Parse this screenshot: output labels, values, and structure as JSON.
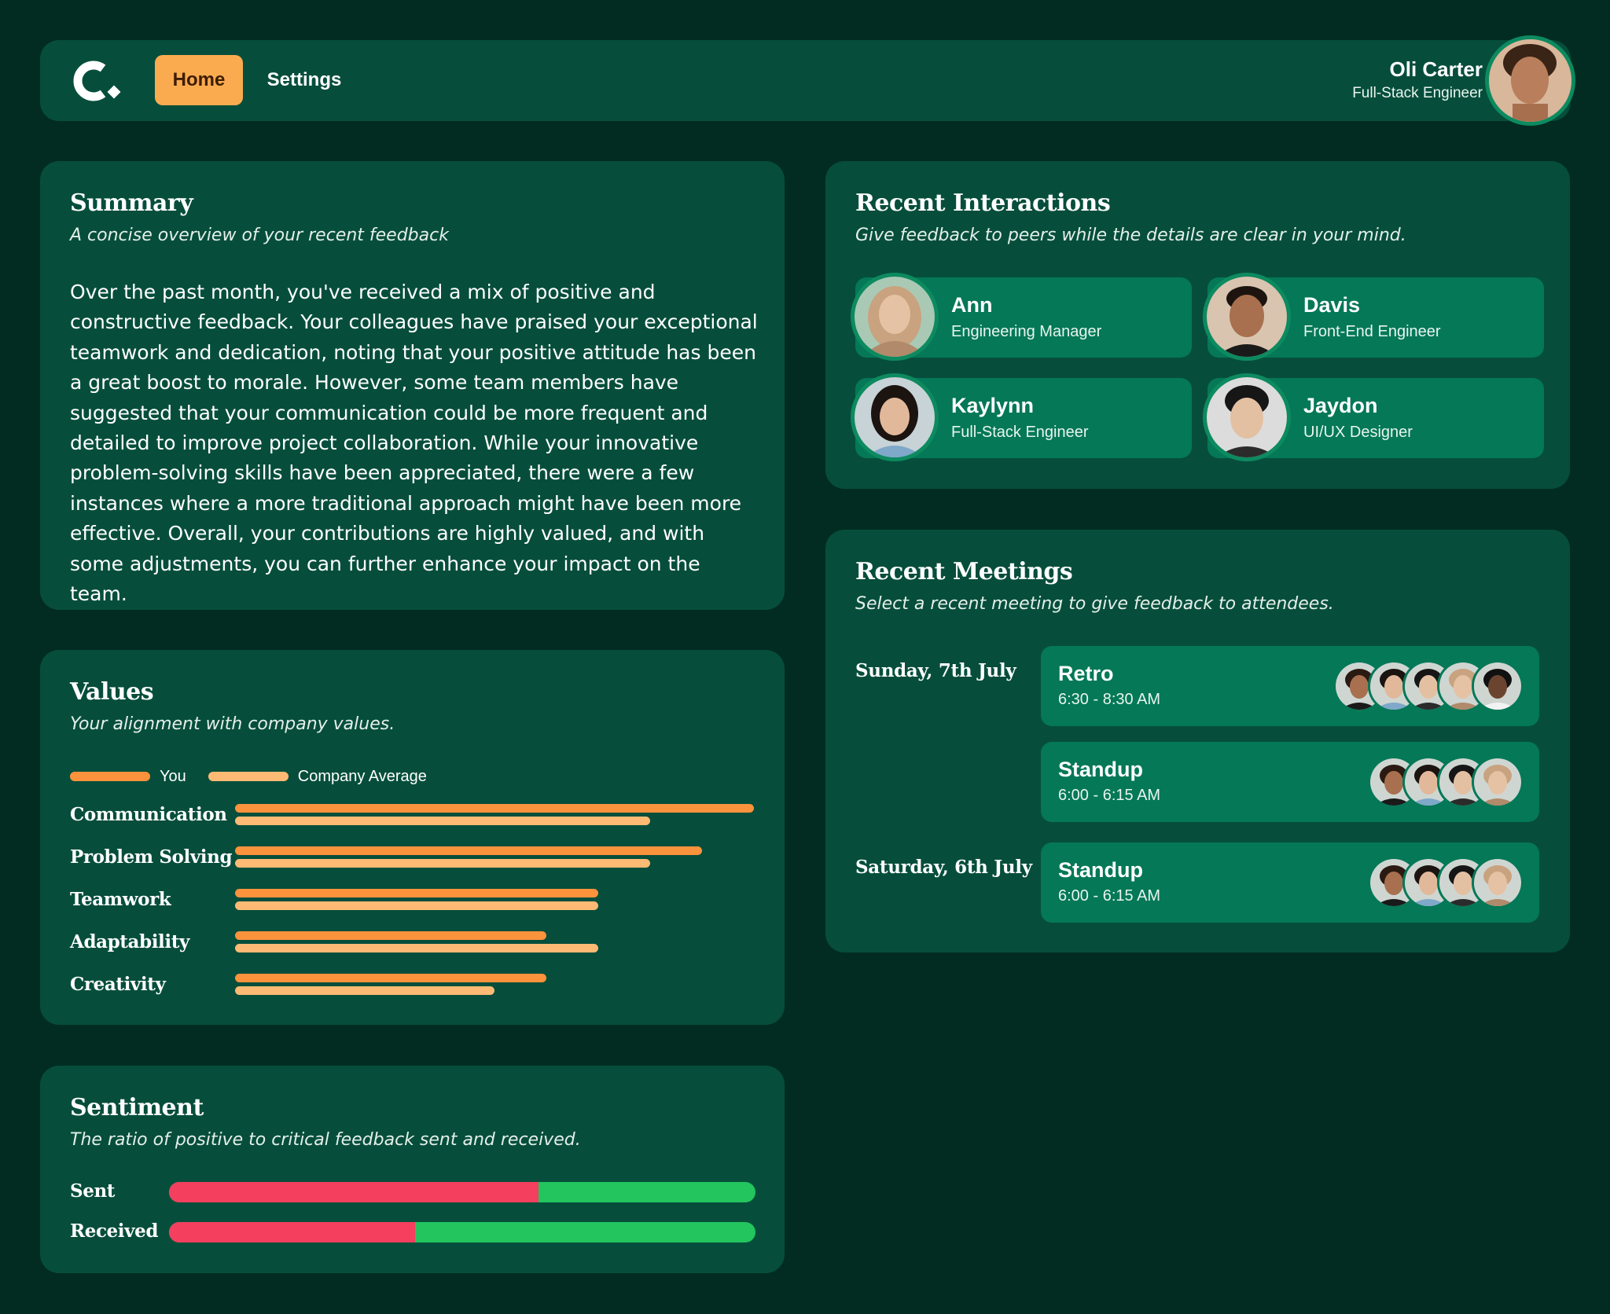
{
  "header": {
    "logo_text": "C.",
    "nav": [
      {
        "label": "Home",
        "active": true
      },
      {
        "label": "Settings",
        "active": false
      }
    ],
    "user": {
      "name": "Oli Carter",
      "role": "Full-Stack Engineer"
    }
  },
  "summary": {
    "title": "Summary",
    "subtitle": "A concise overview of your recent feedback",
    "body": "Over the past month, you've received a mix of positive and constructive feedback. Your colleagues have praised your exceptional teamwork and dedication, noting that your positive attitude has been a great boost to morale. However, some team members have suggested that your communication could be more frequent and detailed to improve project collaboration. While your innovative problem-solving skills have been appreciated, there were a few instances where a more traditional approach might have been more effective. Overall, your contributions are highly valued, and with some adjustments, you can further enhance your impact on the team."
  },
  "values": {
    "title": "Values",
    "subtitle": "Your alignment with company values.",
    "legend": {
      "you": "You",
      "average": "Company Average"
    },
    "colors": {
      "you": "#fb923c",
      "average": "#fdba74"
    },
    "rows": [
      {
        "label": "Communication",
        "you": 100,
        "average": 80
      },
      {
        "label": "Problem Solving",
        "you": 90,
        "average": 80
      },
      {
        "label": "Teamwork",
        "you": 70,
        "average": 70
      },
      {
        "label": "Adaptability",
        "you": 60,
        "average": 70
      },
      {
        "label": "Creativity",
        "you": 60,
        "average": 50
      }
    ]
  },
  "sentiment": {
    "title": "Sentiment",
    "subtitle": "The ratio of positive to critical feedback sent and received.",
    "colors": {
      "critical": "#f43f5e",
      "positive": "#22c55e"
    },
    "rows": [
      {
        "label": "Sent",
        "critical_pct": 63
      },
      {
        "label": "Received",
        "critical_pct": 42
      }
    ]
  },
  "interactions": {
    "title": "Recent Interactions",
    "subtitle": "Give feedback to peers while the details are clear in your mind.",
    "people": [
      {
        "name": "Ann",
        "role": "Engineering Manager"
      },
      {
        "name": "Davis",
        "role": "Front-End Engineer"
      },
      {
        "name": "Kaylynn",
        "role": "Full-Stack Engineer"
      },
      {
        "name": "Jaydon",
        "role": "UI/UX Designer"
      }
    ]
  },
  "meetings": {
    "title": "Recent Meetings",
    "subtitle": "Select a recent meeting to give feedback to attendees.",
    "days": [
      {
        "date": "Sunday, 7th July"
      },
      {
        "date": "Saturday, 6th July"
      }
    ],
    "items": [
      {
        "title": "Retro",
        "time": "6:30 - 8:30 AM",
        "attendee_count": 5
      },
      {
        "title": "Standup",
        "time": "6:00 - 6:15 AM",
        "attendee_count": 4
      },
      {
        "title": "Standup",
        "time": "6:00 - 6:15 AM",
        "attendee_count": 4
      }
    ]
  }
}
